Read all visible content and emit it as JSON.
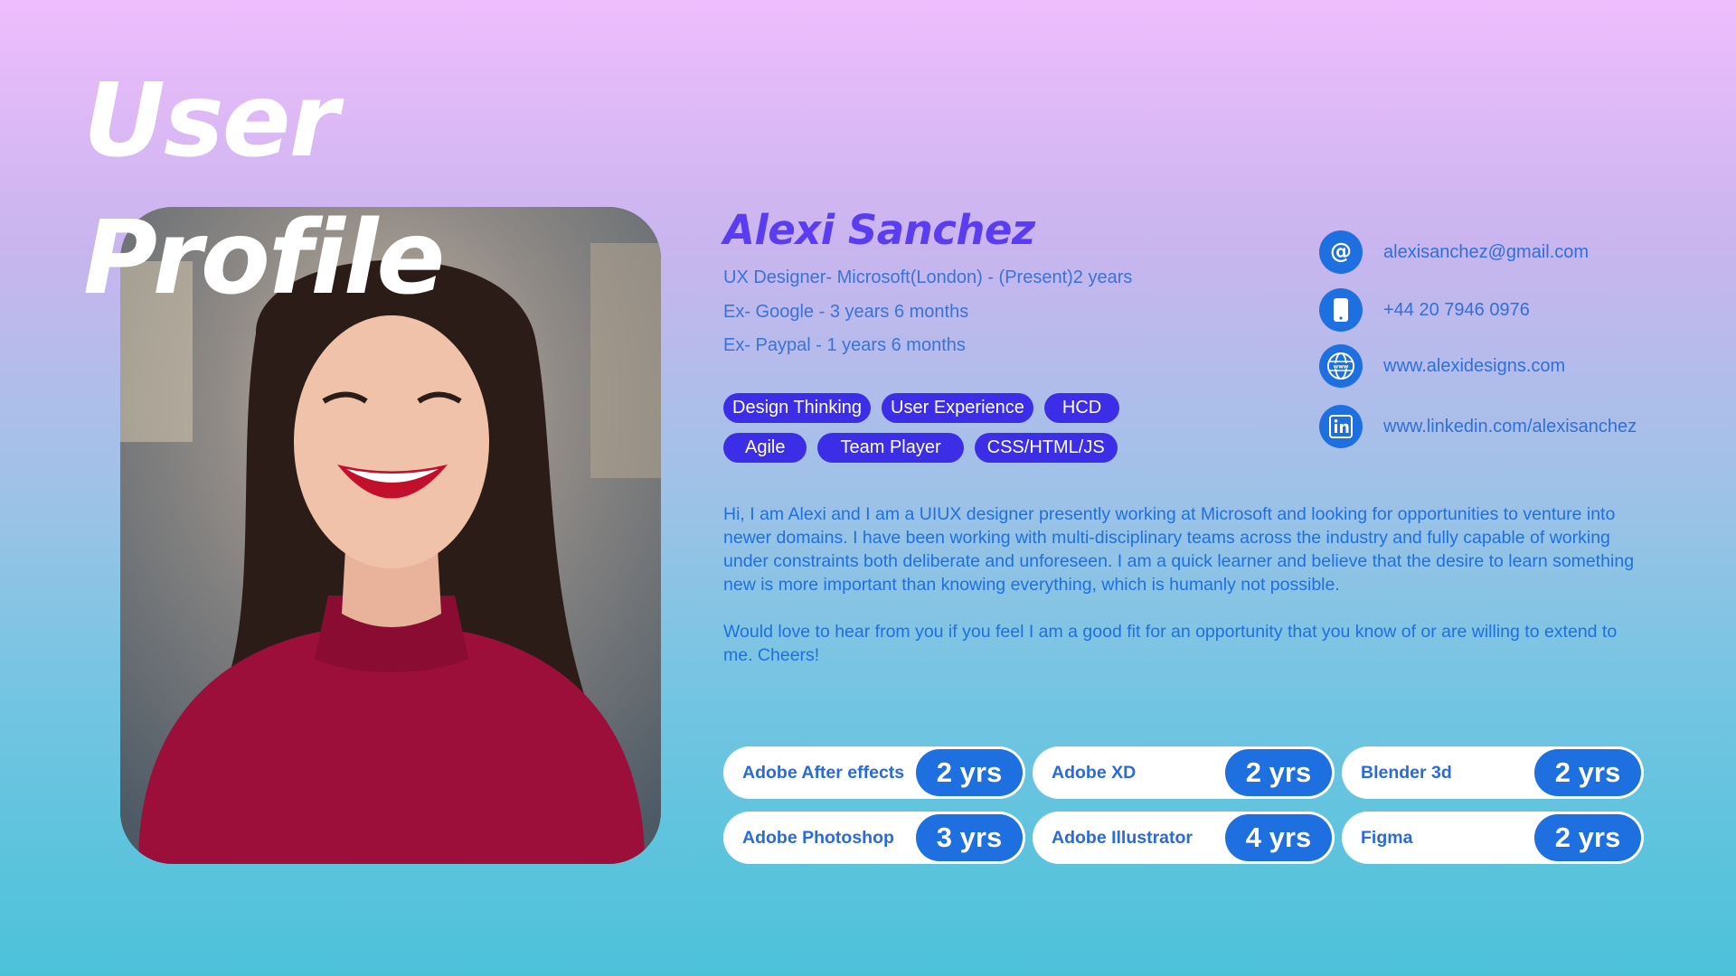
{
  "page": {
    "title": "User Profile"
  },
  "profile": {
    "name": "Alexi Sanchez",
    "experience": [
      "UX Designer- Microsoft(London) - (Present)2 years",
      "Ex- Google - 3 years 6 months",
      "Ex- Paypal - 1 years 6 months"
    ],
    "tags_row1": [
      "Design Thinking",
      "User Experience",
      "HCD"
    ],
    "tags_row2": [
      "Agile",
      "Team Player",
      "CSS/HTML/JS"
    ],
    "bio": [
      "Hi, I am Alexi and I am a UIUX designer presently working at Microsoft and looking for opportunities to venture into newer domains. I have been working with multi-disciplinary teams across the industry and fully capable of working under constraints both deliberate and unforeseen. I am a quick learner and believe that the desire to learn something new is more important than knowing everything, which is humanly not possible.",
      "Would love to hear from you if you feel I am a good fit for an opportunity that you know of or are willing to extend to me. Cheers!"
    ]
  },
  "contacts": [
    {
      "icon": "at-icon",
      "text": "alexisanchez@gmail.com"
    },
    {
      "icon": "phone-icon",
      "text": "+44 20 7946 0976"
    },
    {
      "icon": "globe-icon",
      "text": "www.alexidesigns.com"
    },
    {
      "icon": "linkedin-icon",
      "text": "www.linkedin.com/alexisanchez"
    }
  ],
  "skills": [
    {
      "name": "Adobe After effects",
      "years": "2 yrs"
    },
    {
      "name": "Adobe XD",
      "years": "2 yrs"
    },
    {
      "name": "Blender 3d",
      "years": "2 yrs"
    },
    {
      "name": "Adobe Photoshop",
      "years": "3 yrs"
    },
    {
      "name": "Adobe Illustrator",
      "years": "4 yrs"
    },
    {
      "name": "Figma",
      "years": "2 yrs"
    }
  ],
  "colors": {
    "accent": "#5a3df0",
    "tag": "#3c2ee6",
    "icon": "#1e6fe0",
    "text": "#1f6fe0"
  }
}
